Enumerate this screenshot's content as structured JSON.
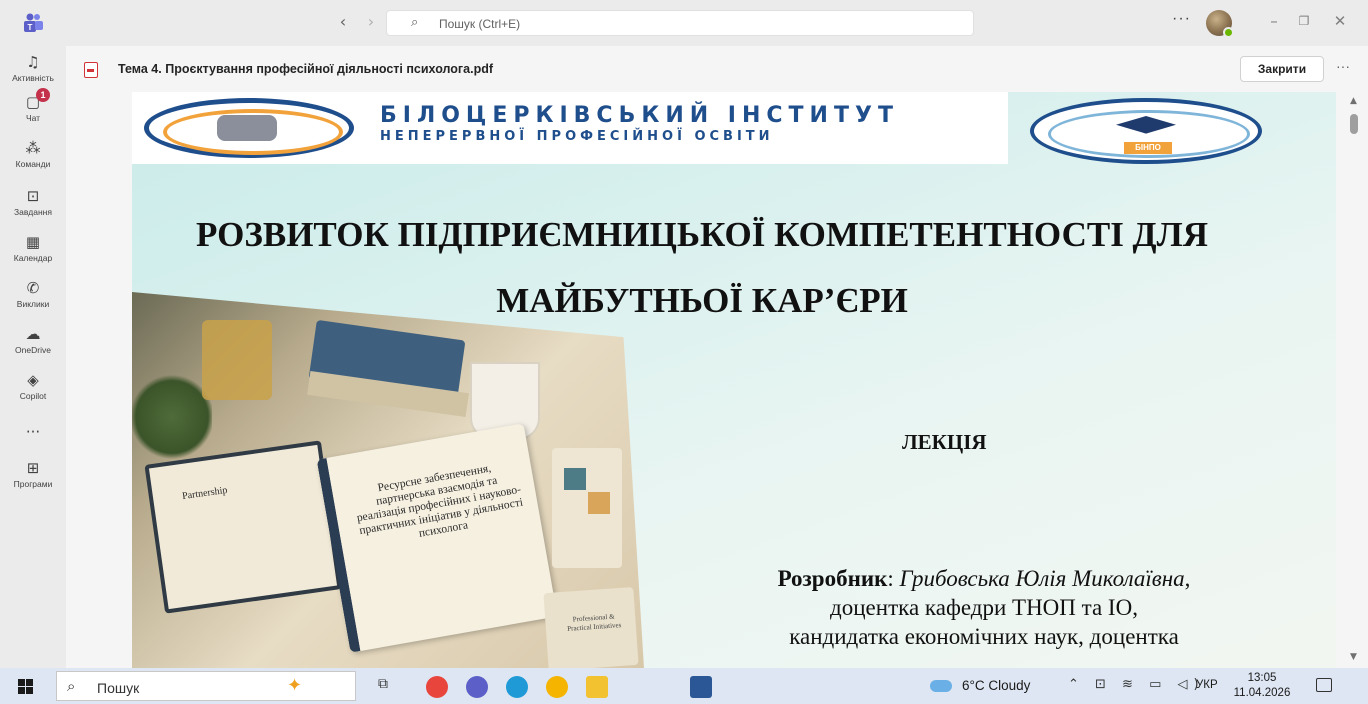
{
  "titlebar": {
    "search_placeholder": "Пошук (Ctrl+E)",
    "more": "···"
  },
  "rail": [
    {
      "label": "Активність",
      "icon": "bell-icon",
      "glyph": "♫"
    },
    {
      "label": "Чат",
      "icon": "chat-icon",
      "glyph": "▢",
      "badge": "1"
    },
    {
      "label": "Команди",
      "icon": "teams-icon",
      "glyph": "⁂"
    },
    {
      "label": "Завдання",
      "icon": "assignments-icon",
      "glyph": "⊡"
    },
    {
      "label": "Календар",
      "icon": "calendar-icon",
      "glyph": "▦"
    },
    {
      "label": "Виклики",
      "icon": "phone-icon",
      "glyph": "✆"
    },
    {
      "label": "OneDrive",
      "icon": "cloud-icon",
      "glyph": "☁"
    },
    {
      "label": "Copilot",
      "icon": "copilot-icon",
      "glyph": "◈"
    },
    {
      "label": "",
      "icon": "more-icon",
      "glyph": "···"
    },
    {
      "label": "Програми",
      "icon": "apps-icon",
      "glyph": "⊞"
    }
  ],
  "file": {
    "name": "Тема 4. Проєктування професійної діяльності психолога.pdf",
    "close_label": "Закрити",
    "more": "···"
  },
  "document": {
    "institute_line1": "БІЛОЦЕРКІВСЬКИЙ ІНСТИТУТ",
    "institute_line2": "НЕПЕРЕРВНОЇ ПРОФЕСІЙНОЇ ОСВІТИ",
    "logo_abbr": "БІНПО",
    "title_line1": "РОЗВИТОК ПІДПРИЄМНИЦЬКОЇ КОМПЕТЕНТНОСТІ ДЛЯ",
    "title_line2": "МАЙБУТНЬОЇ КАР’ЄРИ",
    "lecture": "ЛЕКЦІЯ",
    "author_label": "Розробник",
    "author_name": "Грибовська  Юлія Миколаївна",
    "author_line2": "доцентка кафедри ТНОП та ІО,",
    "author_line3": "кандидатка економічних наук, доцентка",
    "illustration": {
      "notebook_text": "Ресурсне забезпечення, партнерська взаємодія та реалізація професійних і науково-практичних ініціатив у діяльності психолога",
      "clipboard_text": "Partnership",
      "book_text": "Professional & Practical Initiatives"
    }
  },
  "taskbar": {
    "search_label": "Пошук",
    "weather": "6°C  Cloudy",
    "tray": "⌃ ⊡ ≋ ▭ ◁)",
    "language": "УКР",
    "time": "13:05",
    "date": "11.04.2026",
    "apps": [
      {
        "icon": "chrome-icon",
        "color": "#e8453c"
      },
      {
        "icon": "teams-icon",
        "color": "#5b5fc7"
      },
      {
        "icon": "edge-icon",
        "color": "#1f9ad6"
      },
      {
        "icon": "chrome-alt-icon",
        "color": "#f4b400"
      },
      {
        "icon": "file-explorer-icon",
        "color": "#f2c230"
      },
      {
        "icon": "word-icon",
        "color": "#2b5797"
      }
    ]
  }
}
